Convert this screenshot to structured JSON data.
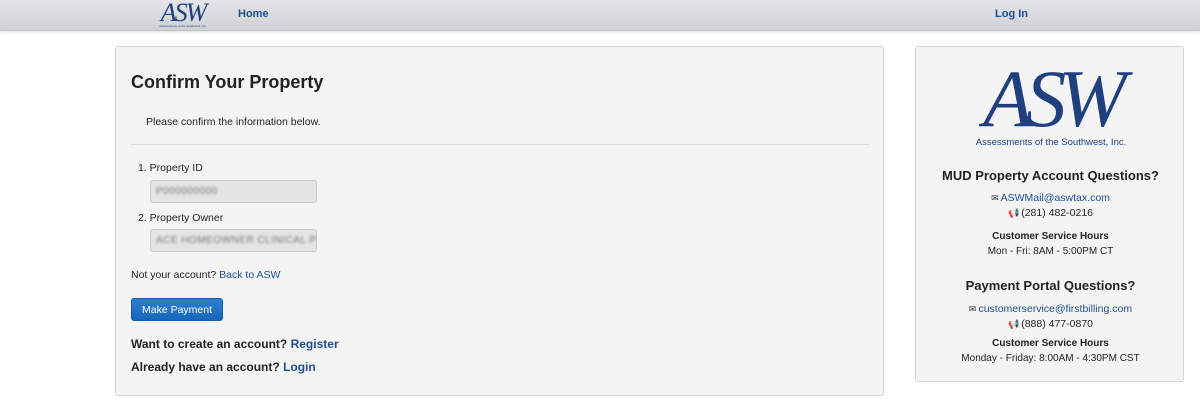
{
  "navbar": {
    "logo_text": "ASW",
    "logo_subtext": "Assessments of the Southwest, Inc.",
    "home_label": "Home",
    "login_label": "Log In"
  },
  "main": {
    "title": "Confirm Your Property",
    "instruction": "Please confirm the information below.",
    "fields": [
      {
        "label": "1. Property ID",
        "value": "P000000000"
      },
      {
        "label": "2. Property Owner",
        "value": "ACE HOMEOWNER CLINICAL PHD"
      }
    ],
    "not_account_text": "Not your account?",
    "back_link": "Back to ASW",
    "pay_button": "Make Payment",
    "create_text": "Want to create an account?",
    "register_link": "Register",
    "already_text": "Already have an account?",
    "login_link": "Login"
  },
  "sidebar": {
    "logo_text": "ASW",
    "logo_subtext": "Assessments of the Southwest, Inc.",
    "mud": {
      "heading": "MUD Property Account Questions?",
      "email": "ASWMail@aswtax.com",
      "phone": "(281) 482-0216",
      "hours_label": "Customer Service Hours",
      "hours": "Mon - Fri: 8AM - 5:00PM CT"
    },
    "portal": {
      "heading": "Payment Portal Questions?",
      "email": "customerservice@firstbilling.com",
      "phone": "(888) 477-0870",
      "hours_label": "Customer Service Hours",
      "hours": "Monday - Friday: 8:00AM - 4:30PM CST"
    }
  },
  "colors": {
    "brand_navy": "#1f3f7f",
    "link": "#1d4f8f",
    "button": "#1866b9"
  },
  "icons": [
    "envelope-icon",
    "megaphone-icon"
  ]
}
